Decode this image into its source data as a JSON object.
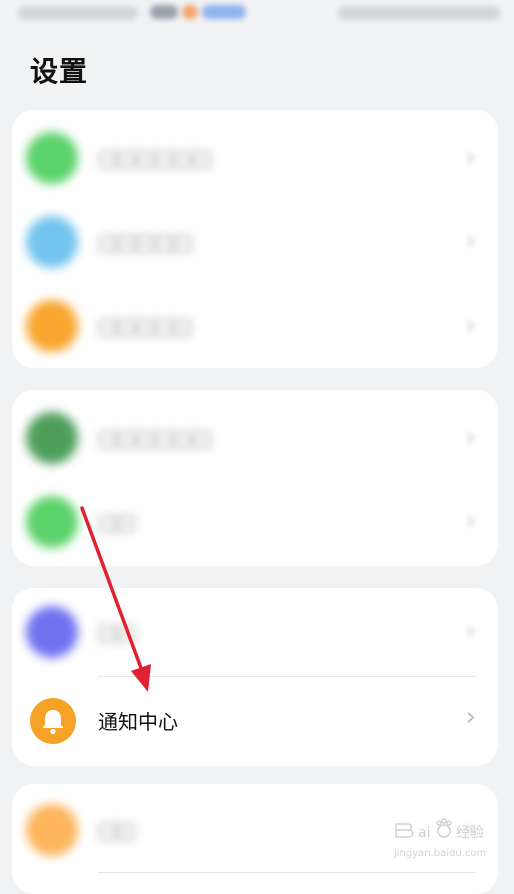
{
  "page_title": "设置",
  "colors": {
    "background": "#f1f2f4",
    "card": "#ffffff",
    "accent_orange": "#f6a227",
    "annotation_arrow": "#e02130"
  },
  "sections": [
    {
      "items": [
        {
          "label": "□□□□□□",
          "icon": "green-circle-icon",
          "color": "#5bd26a"
        },
        {
          "label": "□□□□□",
          "icon": "blue-circle-icon",
          "color": "#72c4ee"
        },
        {
          "label": "□□□□□",
          "icon": "orange-circle-icon",
          "color": "#f9a630"
        }
      ]
    },
    {
      "items": [
        {
          "label": "□□□□□□",
          "icon": "dark-green-circle-icon",
          "color": "#4e9e5a"
        },
        {
          "label": "□□",
          "icon": "green-circle-icon",
          "color": "#5bd26a"
        }
      ]
    },
    {
      "items": [
        {
          "label": "□□",
          "icon": "purple-circle-icon",
          "color": "#6f73f0"
        },
        {
          "label": "通知中心",
          "icon": "bell-icon",
          "color": "#f6a227"
        }
      ]
    },
    {
      "items": [
        {
          "label": "□□",
          "icon": "orange-circle-icon",
          "color": "#fdb55c"
        }
      ]
    }
  ],
  "chevron": "›"
}
